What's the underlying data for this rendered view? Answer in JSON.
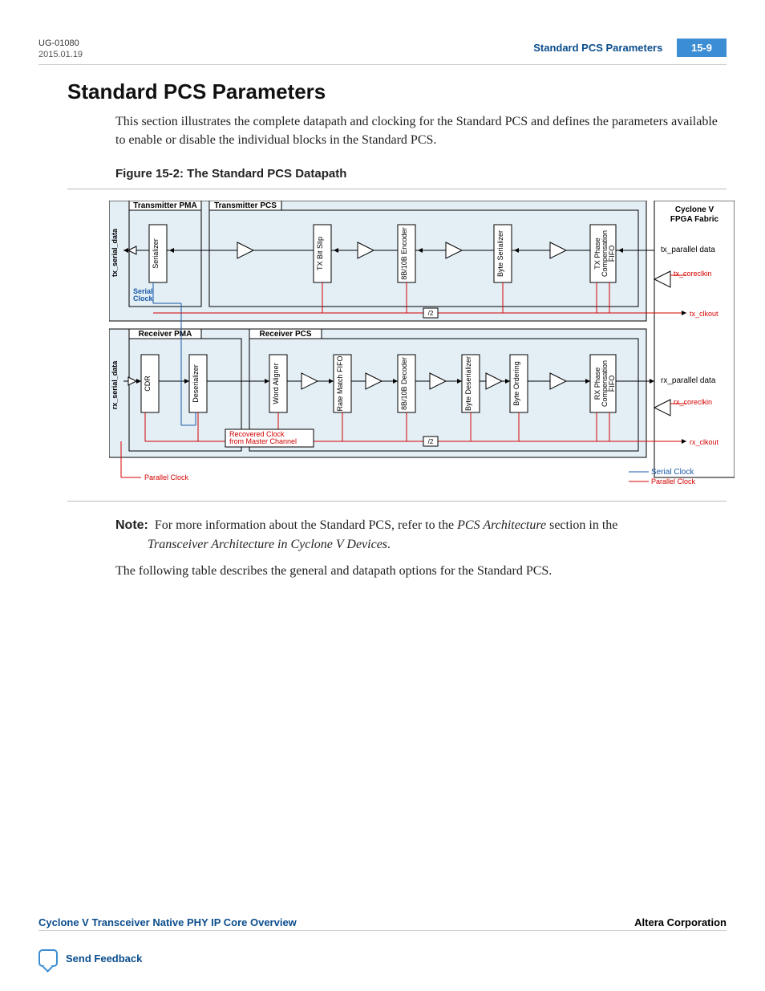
{
  "header": {
    "doc_id": "UG-01080",
    "date": "2015.01.19",
    "title": "Standard PCS Parameters",
    "pageno": "15-9"
  },
  "section": {
    "heading": "Standard PCS Parameters",
    "intro": "This section illustrates the complete datapath and clocking for the Standard PCS and defines the parameters available to enable or disable the individual blocks in the Standard PCS.",
    "figure_caption": "Figure 15-2: The Standard PCS Datapath",
    "note_label": "Note:",
    "note_text_1": "For more information about the Standard PCS, refer to the ",
    "note_em_1": "PCS Architecture",
    "note_text_2": " section in the ",
    "note_em_2": "Transceiver Architecture in Cyclone V Devices",
    "note_text_3": ".",
    "table_intro": "The following table describes the general and datapath options for the Standard PCS."
  },
  "diagram": {
    "tx_pma_title": "Transmitter PMA",
    "tx_pcs_title": "Transmitter PCS",
    "rx_pma_title": "Receiver PMA",
    "rx_pcs_title": "Receiver PCS",
    "fabric_l1": "Cyclone V",
    "fabric_l2": "FPGA Fabric",
    "tx_side": "tx_serial_data",
    "rx_side": "rx_serial_data",
    "serial_clock": "Serial\nClock",
    "tx_blocks": [
      "Serializer",
      "TX Bit Slip",
      "8B/10B Encoder",
      "Byte Serializer",
      "TX Phase\nCompensation\nFIFO"
    ],
    "rx_blocks": [
      "CDR",
      "Deserializer",
      "Word Aligner",
      "Rate Match FIFO",
      "8B/10B Decoder",
      "Byte Deserializer",
      "Byte Ordering",
      "RX Phase\nCompensation\nFIFO"
    ],
    "tx_parallel": "tx_parallel data",
    "tx_coreclkin": "tx_coreclkin",
    "tx_clkout": "tx_clkout",
    "rx_parallel": "rx_parallel data",
    "rx_coreclkin": "rx_coreclkin",
    "rx_clkout": "rx_clkout",
    "div2": "/2",
    "recovered": "Recovered Clock\nfrom Master Channel",
    "legend_parallel": "Parallel Clock",
    "legend_serial": "Serial Clock",
    "legend_parallel2": "Parallel Clock"
  },
  "footer": {
    "left": "Cyclone V Transceiver Native PHY IP Core Overview",
    "right": "Altera Corporation",
    "feedback": "Send Feedback"
  }
}
